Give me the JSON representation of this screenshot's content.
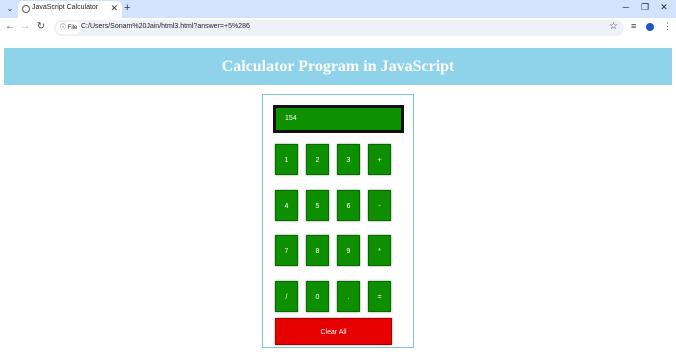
{
  "browser": {
    "tab_title": "JavaScript Calculator",
    "url": "C:/Users/Sonam%20Jain/html3.html?answer=+5%286",
    "info_label": "File"
  },
  "page": {
    "heading": "Calculator Program in JavaScript"
  },
  "calculator": {
    "display_value": "154",
    "keys": [
      [
        "1",
        "2",
        "3",
        "+"
      ],
      [
        "4",
        "5",
        "6",
        "-"
      ],
      [
        "7",
        "8",
        "9",
        "*"
      ],
      [
        "/",
        "0",
        ".",
        "="
      ]
    ],
    "clear_label": "Clear All"
  },
  "colors": {
    "banner": "#8fd3ea",
    "key_green": "#0e8f00",
    "clear_red": "#e60000"
  }
}
